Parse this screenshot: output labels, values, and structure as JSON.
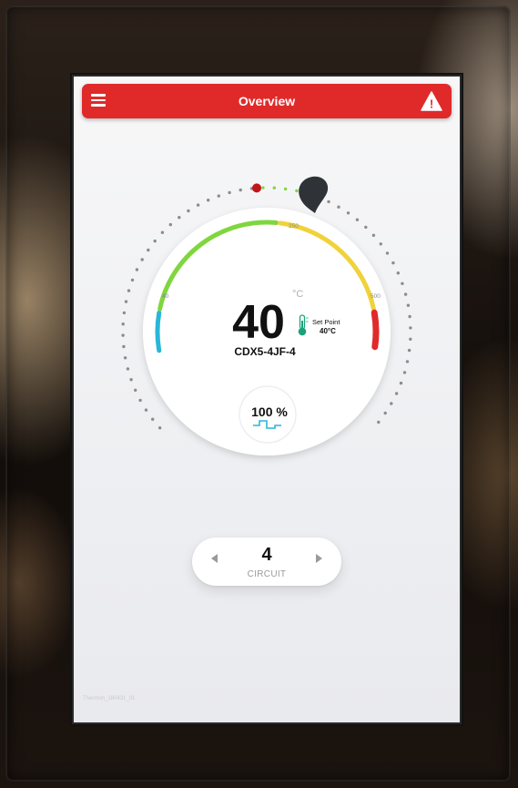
{
  "header": {
    "title": "Overview",
    "menu_icon": "hamburger-menu-icon",
    "alert_icon": "warning-triangle-icon",
    "alert_symbol": "!",
    "accent_color": "#e02a2a"
  },
  "gauge": {
    "temperature": "40",
    "unit": "°C",
    "device_name": "CDX5-4JF-4",
    "setpoint_label": "Set Point",
    "setpoint_value": "40°C",
    "scale_min": "40",
    "scale_mid": "250",
    "scale_max": "500",
    "output_percent": "100 %",
    "output_icon": "square-wave-icon",
    "thermometer_icon": "thermometer-icon",
    "colors": {
      "low": "#27b7d8",
      "normal": "#7fd63e",
      "warning": "#f0d23a",
      "high": "#e02a2a"
    }
  },
  "circuit": {
    "value": "4",
    "label": "CIRCUIT"
  },
  "footer": {
    "id_text": "Thermon_180431_01"
  }
}
